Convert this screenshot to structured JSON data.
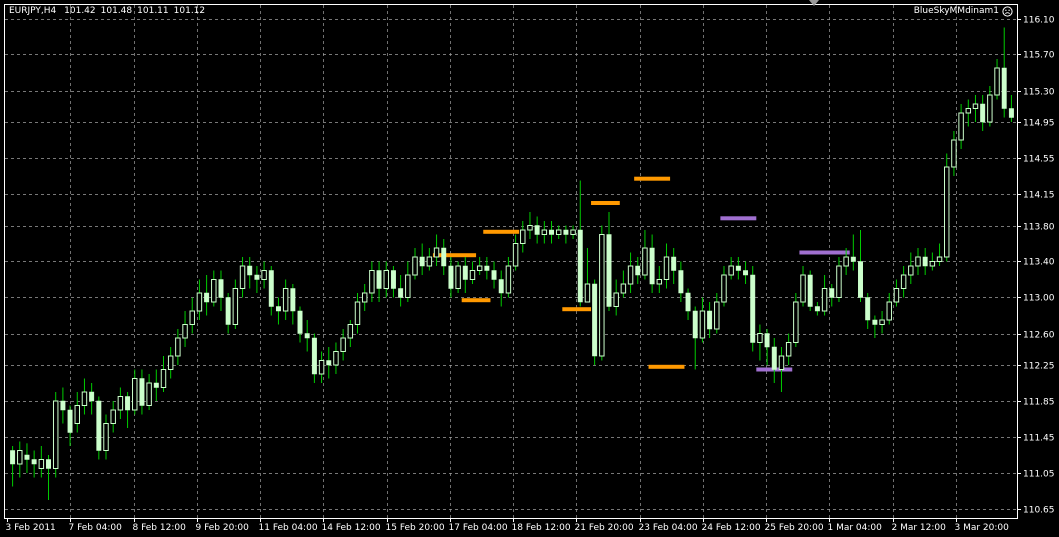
{
  "header": {
    "symbol": "EURJPY,H4",
    "open": "101.42",
    "high": "101.48",
    "low": "101.11",
    "close": "101.12",
    "indicator_name": "BlueSkyMMdinam1"
  },
  "colors": {
    "background": "#000000",
    "grid": "#a0a0a0",
    "candle": "#ccffcc",
    "wick": "#00cc00",
    "level_orange": "#ff9900",
    "level_purple": "#a070d0",
    "text": "#ffffff"
  },
  "chart_data": {
    "type": "candlestick",
    "symbol": "EURJPY",
    "timeframe": "H4",
    "y_ticks": [
      "116.10",
      "115.70",
      "115.30",
      "114.95",
      "114.55",
      "114.15",
      "113.80",
      "113.40",
      "113.00",
      "112.60",
      "112.25",
      "111.85",
      "111.45",
      "111.05",
      "110.65"
    ],
    "y_range": [
      110.55,
      116.25
    ],
    "x_ticks": [
      "3 Feb 2011",
      "7 Feb 04:00",
      "8 Feb 12:00",
      "9 Feb 20:00",
      "11 Feb 04:00",
      "14 Feb 12:00",
      "15 Feb 20:00",
      "17 Feb 04:00",
      "18 Feb 12:00",
      "21 Feb 20:00",
      "23 Feb 04:00",
      "24 Feb 12:00",
      "25 Feb 20:00",
      "1 Mar 04:00",
      "2 Mar 12:00",
      "3 Mar 20:00"
    ],
    "candles": [
      [
        111.3,
        111.15,
        111.35,
        110.9
      ],
      [
        111.15,
        111.3,
        111.4,
        111.0
      ],
      [
        111.25,
        111.2,
        111.38,
        111.05
      ],
      [
        111.2,
        111.15,
        111.3,
        111.0
      ],
      [
        111.1,
        111.2,
        111.35,
        111.0
      ],
      [
        111.2,
        111.1,
        111.25,
        110.75
      ],
      [
        111.1,
        111.85,
        111.95,
        111.0
      ],
      [
        111.85,
        111.75,
        112.0,
        111.6
      ],
      [
        111.75,
        111.5,
        111.8,
        111.35
      ],
      [
        111.6,
        111.8,
        111.95,
        111.5
      ],
      [
        111.8,
        111.95,
        112.1,
        111.7
      ],
      [
        111.95,
        111.85,
        112.05,
        111.7
      ],
      [
        111.85,
        111.3,
        111.9,
        111.2
      ],
      [
        111.3,
        111.6,
        111.7,
        111.2
      ],
      [
        111.6,
        111.75,
        111.85,
        111.5
      ],
      [
        111.75,
        111.9,
        112.0,
        111.65
      ],
      [
        111.9,
        111.75,
        111.95,
        111.55
      ],
      [
        111.75,
        112.1,
        112.2,
        111.7
      ],
      [
        112.1,
        111.8,
        112.2,
        111.7
      ],
      [
        111.8,
        112.05,
        112.15,
        111.75
      ],
      [
        112.05,
        112.0,
        112.2,
        111.85
      ],
      [
        112.0,
        112.2,
        112.35,
        111.95
      ],
      [
        112.2,
        112.35,
        112.45,
        112.1
      ],
      [
        112.35,
        112.55,
        112.65,
        112.25
      ],
      [
        112.55,
        112.7,
        112.85,
        112.45
      ],
      [
        112.7,
        112.85,
        113.0,
        112.6
      ],
      [
        112.85,
        113.05,
        113.2,
        112.75
      ],
      [
        113.05,
        112.95,
        113.25,
        112.8
      ],
      [
        112.95,
        113.2,
        113.3,
        112.9
      ],
      [
        113.2,
        113.0,
        113.3,
        112.85
      ],
      [
        113.0,
        112.7,
        113.05,
        112.6
      ],
      [
        112.7,
        113.1,
        113.2,
        112.65
      ],
      [
        113.1,
        113.35,
        113.45,
        113.0
      ],
      [
        113.35,
        113.25,
        113.45,
        113.1
      ],
      [
        113.25,
        113.2,
        113.35,
        113.05
      ],
      [
        113.2,
        113.3,
        113.4,
        113.1
      ],
      [
        113.3,
        112.9,
        113.35,
        112.8
      ],
      [
        112.9,
        112.85,
        113.0,
        112.7
      ],
      [
        112.85,
        113.1,
        113.2,
        112.75
      ],
      [
        113.1,
        112.85,
        113.15,
        112.7
      ],
      [
        112.85,
        112.6,
        112.9,
        112.5
      ],
      [
        112.6,
        112.55,
        112.75,
        112.4
      ],
      [
        112.55,
        112.15,
        112.6,
        112.05
      ],
      [
        112.15,
        112.3,
        112.4,
        112.05
      ],
      [
        112.3,
        112.25,
        112.45,
        112.1
      ],
      [
        112.25,
        112.4,
        112.5,
        112.15
      ],
      [
        112.4,
        112.55,
        112.65,
        112.3
      ],
      [
        112.55,
        112.7,
        112.75,
        112.45
      ],
      [
        112.7,
        112.95,
        113.05,
        112.6
      ],
      [
        112.95,
        113.05,
        113.15,
        112.85
      ],
      [
        113.05,
        113.3,
        113.4,
        112.95
      ],
      [
        113.3,
        113.1,
        113.4,
        112.95
      ],
      [
        113.1,
        113.3,
        113.4,
        113.0
      ],
      [
        113.3,
        113.1,
        113.35,
        113.0
      ],
      [
        113.1,
        113.0,
        113.25,
        112.9
      ],
      [
        113.0,
        113.25,
        113.4,
        112.95
      ],
      [
        113.25,
        113.45,
        113.55,
        113.2
      ],
      [
        113.45,
        113.35,
        113.6,
        113.25
      ],
      [
        113.35,
        113.45,
        113.55,
        113.3
      ],
      [
        113.45,
        113.55,
        113.7,
        113.35
      ],
      [
        113.55,
        113.35,
        113.65,
        113.25
      ],
      [
        113.35,
        113.1,
        113.45,
        113.0
      ],
      [
        113.1,
        113.35,
        113.4,
        113.05
      ],
      [
        113.35,
        113.2,
        113.45,
        113.05
      ],
      [
        113.2,
        113.3,
        113.4,
        113.15
      ],
      [
        113.3,
        113.35,
        113.45,
        113.25
      ],
      [
        113.35,
        113.3,
        113.45,
        113.2
      ],
      [
        113.3,
        113.2,
        113.4,
        113.1
      ],
      [
        113.2,
        113.05,
        113.3,
        112.9
      ],
      [
        113.05,
        113.35,
        113.45,
        113.0
      ],
      [
        113.35,
        113.6,
        113.7,
        113.3
      ],
      [
        113.6,
        113.75,
        113.85,
        113.5
      ],
      [
        113.75,
        113.8,
        113.95,
        113.65
      ],
      [
        113.8,
        113.7,
        113.9,
        113.6
      ],
      [
        113.7,
        113.75,
        113.85,
        113.6
      ],
      [
        113.75,
        113.7,
        113.85,
        113.6
      ],
      [
        113.7,
        113.75,
        113.8,
        113.65
      ],
      [
        113.75,
        113.7,
        113.8,
        113.6
      ],
      [
        113.7,
        113.75,
        113.8,
        113.65
      ],
      [
        113.75,
        112.95,
        114.3,
        112.9
      ],
      [
        112.95,
        113.15,
        113.55,
        113.0
      ],
      [
        113.15,
        112.35,
        113.2,
        112.25
      ],
      [
        112.35,
        113.7,
        113.8,
        112.3
      ],
      [
        113.7,
        112.9,
        113.95,
        112.85
      ],
      [
        112.9,
        113.05,
        113.2,
        112.8
      ],
      [
        113.05,
        113.15,
        113.3,
        113.0
      ],
      [
        113.15,
        113.35,
        113.5,
        113.05
      ],
      [
        113.35,
        113.25,
        113.45,
        113.15
      ],
      [
        113.25,
        113.55,
        113.75,
        113.2
      ],
      [
        113.55,
        113.15,
        113.7,
        113.05
      ],
      [
        113.15,
        113.2,
        113.35,
        113.05
      ],
      [
        113.2,
        113.45,
        113.6,
        113.1
      ],
      [
        113.45,
        113.3,
        113.55,
        113.15
      ],
      [
        113.3,
        113.05,
        113.4,
        112.95
      ],
      [
        113.05,
        112.85,
        113.1,
        112.75
      ],
      [
        112.85,
        112.55,
        112.9,
        112.2
      ],
      [
        112.55,
        112.85,
        113.0,
        112.5
      ],
      [
        112.85,
        112.65,
        112.95,
        112.55
      ],
      [
        112.65,
        112.95,
        113.05,
        112.6
      ],
      [
        112.95,
        113.25,
        113.35,
        112.9
      ],
      [
        113.25,
        113.35,
        113.45,
        113.2
      ],
      [
        113.35,
        113.3,
        113.45,
        113.2
      ],
      [
        113.3,
        113.25,
        113.4,
        113.15
      ],
      [
        113.25,
        112.5,
        113.35,
        112.4
      ],
      [
        112.5,
        112.6,
        112.7,
        112.3
      ],
      [
        112.6,
        112.45,
        112.65,
        112.25
      ],
      [
        112.45,
        112.2,
        112.55,
        112.05
      ],
      [
        112.2,
        112.35,
        112.45,
        111.95
      ],
      [
        112.35,
        112.5,
        112.6,
        112.25
      ],
      [
        112.5,
        112.95,
        113.05,
        112.45
      ],
      [
        112.95,
        113.25,
        113.35,
        112.9
      ],
      [
        113.25,
        112.9,
        113.3,
        112.85
      ],
      [
        112.9,
        112.85,
        112.95,
        112.8
      ],
      [
        112.85,
        113.1,
        113.25,
        112.8
      ],
      [
        113.1,
        113.0,
        113.15,
        112.9
      ],
      [
        113.0,
        113.35,
        113.45,
        112.95
      ],
      [
        113.35,
        113.45,
        113.55,
        113.25
      ],
      [
        113.45,
        113.4,
        113.7,
        113.3
      ],
      [
        113.4,
        113.0,
        113.75,
        112.95
      ],
      [
        113.0,
        112.75,
        113.05,
        112.65
      ],
      [
        112.75,
        112.7,
        112.8,
        112.55
      ],
      [
        112.7,
        112.75,
        112.85,
        112.6
      ],
      [
        112.75,
        112.95,
        113.05,
        112.7
      ],
      [
        112.95,
        113.1,
        113.2,
        112.9
      ],
      [
        113.1,
        113.25,
        113.35,
        113.0
      ],
      [
        113.25,
        113.35,
        113.5,
        113.15
      ],
      [
        113.35,
        113.45,
        113.55,
        113.25
      ],
      [
        113.45,
        113.35,
        113.55,
        113.25
      ],
      [
        113.35,
        113.4,
        113.5,
        113.3
      ],
      [
        113.4,
        113.45,
        113.6,
        113.35
      ],
      [
        113.45,
        114.45,
        114.6,
        113.4
      ],
      [
        114.45,
        114.75,
        114.85,
        114.35
      ],
      [
        114.75,
        115.05,
        115.15,
        114.65
      ],
      [
        115.05,
        115.1,
        115.2,
        114.9
      ],
      [
        115.1,
        115.15,
        115.25,
        114.95
      ],
      [
        115.15,
        114.95,
        115.25,
        114.85
      ],
      [
        114.95,
        115.25,
        115.35,
        114.9
      ],
      [
        115.25,
        115.55,
        115.65,
        115.2
      ],
      [
        115.55,
        115.1,
        116.0,
        115.0
      ],
      [
        115.1,
        115.0,
        115.25,
        114.95
      ]
    ],
    "levels": [
      {
        "color": "orange",
        "price": 113.47,
        "from": 59,
        "to": 64
      },
      {
        "color": "orange",
        "price": 112.97,
        "from": 63,
        "to": 66
      },
      {
        "color": "orange",
        "price": 113.73,
        "from": 66,
        "to": 70
      },
      {
        "color": "orange",
        "price": 112.87,
        "from": 77,
        "to": 80
      },
      {
        "color": "orange",
        "price": 114.05,
        "from": 81,
        "to": 84
      },
      {
        "color": "orange",
        "price": 114.32,
        "from": 87,
        "to": 91
      },
      {
        "color": "orange",
        "price": 112.23,
        "from": 89,
        "to": 93
      },
      {
        "color": "purple",
        "price": 113.88,
        "from": 99,
        "to": 103
      },
      {
        "color": "purple",
        "price": 112.2,
        "from": 104,
        "to": 108
      },
      {
        "color": "purple",
        "price": 113.5,
        "from": 110,
        "to": 116
      }
    ]
  }
}
